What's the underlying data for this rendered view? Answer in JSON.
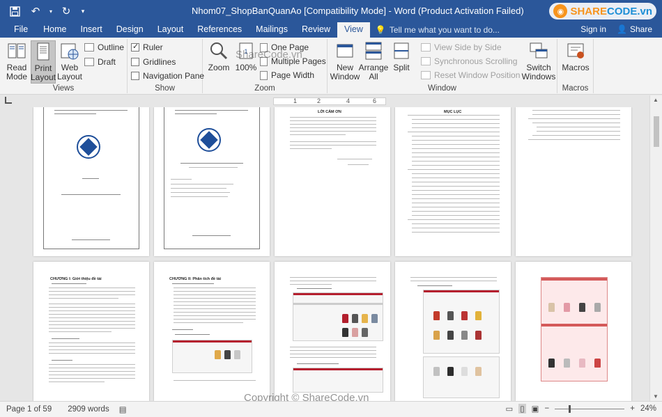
{
  "window": {
    "title": "Nhom07_ShopBanQuanAo [Compatibility Mode] - Word (Product Activation Failed)",
    "logo_text": "SHARECODE.vn",
    "logo_bold": "SHARE",
    "logo_rest": "CODE.vn"
  },
  "tabs": [
    {
      "label": "File"
    },
    {
      "label": "Home"
    },
    {
      "label": "Insert"
    },
    {
      "label": "Design"
    },
    {
      "label": "Layout"
    },
    {
      "label": "References"
    },
    {
      "label": "Mailings"
    },
    {
      "label": "Review"
    },
    {
      "label": "View"
    }
  ],
  "tellme_placeholder": "Tell me what you want to do...",
  "signin": "Sign in",
  "share": "Share",
  "ribbon": {
    "views": {
      "label": "Views",
      "read_mode": "Read Mode",
      "read_mode_l1": "Read",
      "read_mode_l2": "Mode",
      "print_l1": "Print",
      "print_l2": "Layout",
      "web_l1": "Web",
      "web_l2": "Layout",
      "outline": "Outline",
      "draft": "Draft"
    },
    "show": {
      "label": "Show",
      "ruler": "Ruler",
      "gridlines": "Gridlines",
      "navigation_pane": "Navigation Pane",
      "ruler_checked": true,
      "gridlines_checked": false,
      "navigation_checked": false
    },
    "zoom": {
      "label": "Zoom",
      "zoom": "Zoom",
      "hundred": "100%",
      "one_page": "One Page",
      "multiple_pages": "Multiple Pages",
      "page_width": "Page Width"
    },
    "window": {
      "label": "Window",
      "new_l1": "New",
      "new_l2": "Window",
      "arrange_l1": "Arrange",
      "arrange_l2": "All",
      "split": "Split",
      "side_by_side": "View Side by Side",
      "sync_scroll": "Synchronous Scrolling",
      "reset_position": "Reset Window Position",
      "switch_l1": "Switch",
      "switch_l2": "Windows"
    },
    "macros": {
      "label": "Macros",
      "macros": "Macros"
    }
  },
  "ruler": {
    "ticks": [
      "1",
      "2",
      "4",
      "6"
    ]
  },
  "pages": {
    "p3_title": "LỜI CẢM ƠN",
    "p4_title": "MỤC LỤC",
    "p6_title": "CHƯƠNG I: Giới thiệu đề tài",
    "p7_title": "CHƯƠNG II: Phân tích đề tài"
  },
  "status": {
    "page": "Page 1 of 59",
    "words": "2909 words",
    "zoom": "24%"
  },
  "watermark": "Copyright © ShareCode.vn",
  "watermark_top": "ShareCode.vn",
  "colors": {
    "word_blue": "#2b579a",
    "ribbon_bg": "#f3f3f3",
    "canvas_bg": "#e6e6e6"
  }
}
